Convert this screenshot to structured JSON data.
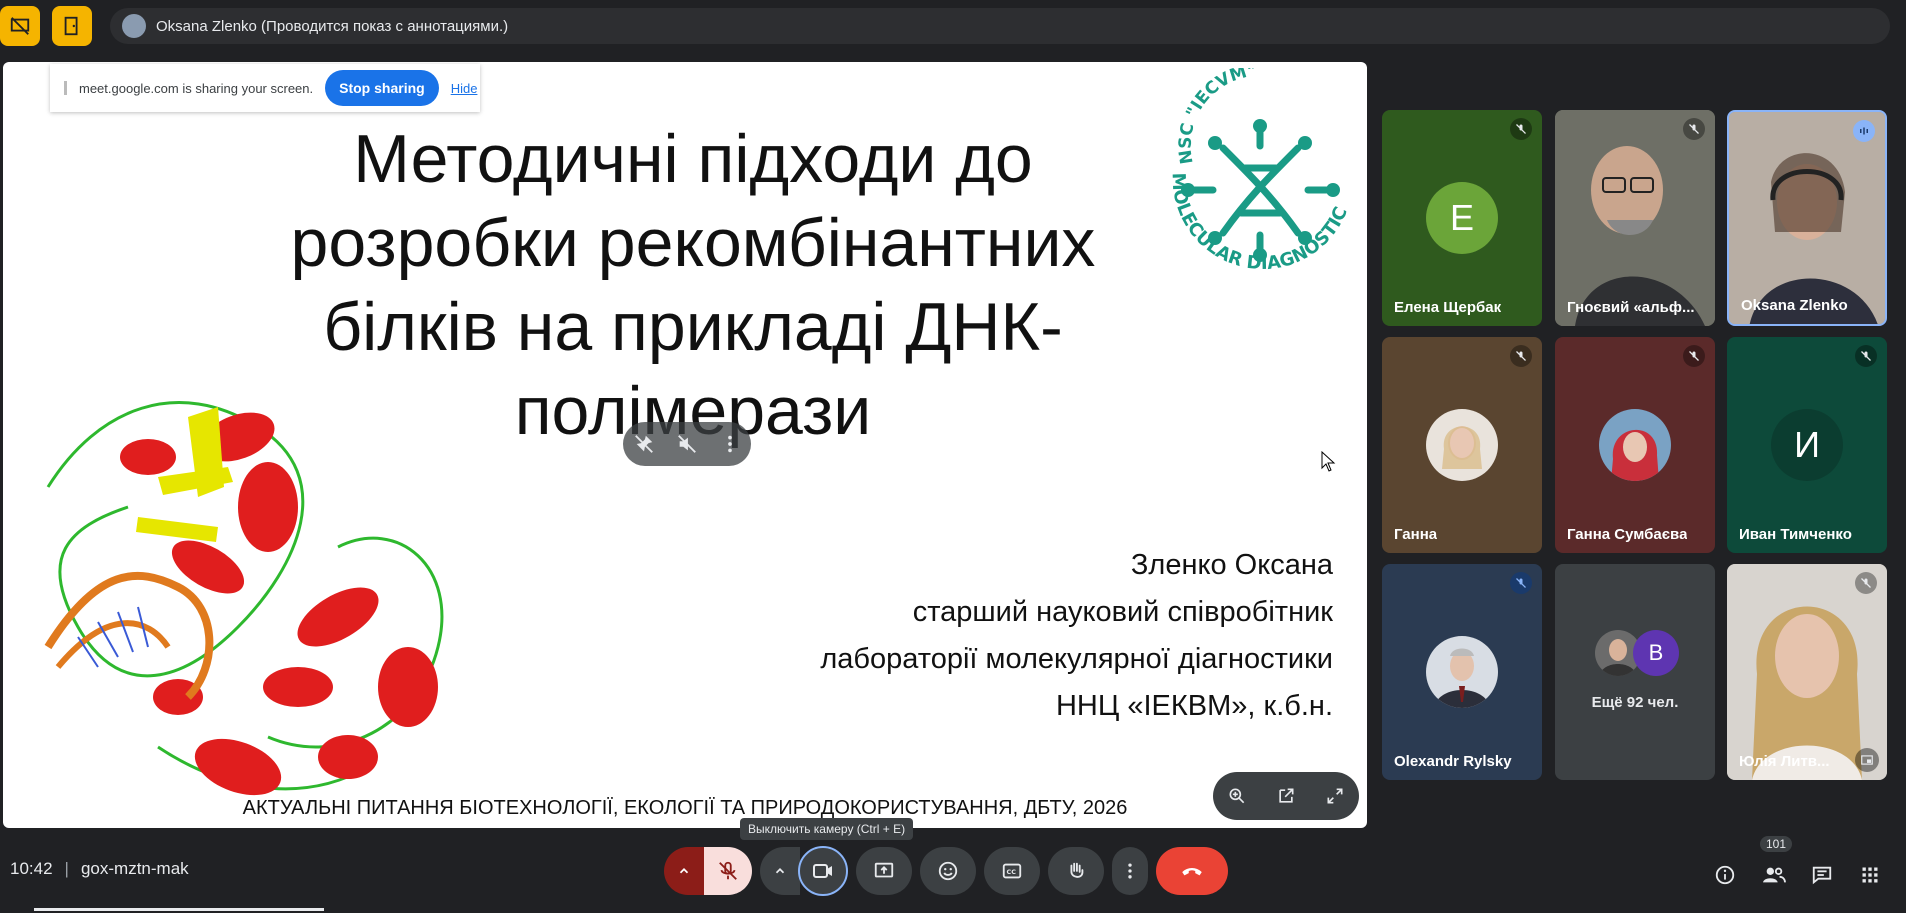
{
  "presenter_banner": "Oksana Zlenko (Проводится показ с аннотациями.)",
  "share_notice": {
    "text": "meet.google.com is sharing your screen.",
    "stop_label": "Stop sharing",
    "hide_label": "Hide"
  },
  "slide": {
    "title_lines": [
      "Методичні підходи до",
      "розробки рекомбінантних",
      "білків на прикладі ДНК-",
      "полімерази"
    ],
    "logo_top": "NSC \"IECVM\"",
    "logo_bottom": "MOLECULAR DIAGNOSTICS",
    "author_lines": [
      "Зленко Оксана",
      "старший науковий співробітник",
      "лабораторії молекулярної діагностики",
      "ННЦ «ІЕКВМ», к.б.н."
    ],
    "footer": "АКТУАЛЬНІ ПИТАННЯ БІОТЕХНОЛОГІЇ, ЕКОЛОГІЇ ТА ПРИРОДОКОРИСТУВАННЯ, ДБТУ, 2026"
  },
  "participants": [
    {
      "name": "Елена Щербак",
      "initial": "E",
      "bg": "#2f5a1e",
      "avatar_color": "#6ba539",
      "muted": true
    },
    {
      "name": "Гноєвий «альф...",
      "initial": "",
      "bg": "#6b6e62",
      "muted": true
    },
    {
      "name": "Oksana Zlenko",
      "initial": "",
      "bg": "#a89c8f",
      "speaking": true
    },
    {
      "name": "Ганна",
      "initial": "",
      "bg": "#5a4530",
      "muted": true
    },
    {
      "name": "Ганна Сумбаєва",
      "initial": "",
      "bg": "#5b2a2a",
      "muted": true
    },
    {
      "name": "Иван Тимченко",
      "initial": "И",
      "bg": "#0d4a3a",
      "avatar_color": "#0b3d30",
      "muted": true
    },
    {
      "name": "Olexandr Rylsky",
      "initial": "",
      "bg": "#2b3b52",
      "muted": true
    },
    {
      "name": "Ещё 92 чел.",
      "initial": "B",
      "bg": "#3c4043",
      "avatar_color": "#5e35b1"
    },
    {
      "name": "Юлія Литв...",
      "initial": "",
      "bg": "#8a8480",
      "muted": true
    }
  ],
  "bottom": {
    "time": "10:42",
    "meeting_code": "gox-mztn-mak",
    "tooltip": "Выключить камеру (Ctrl + E)",
    "participant_count": "101"
  },
  "colors": {
    "accent_yellow": "#f5b400",
    "hangup_red": "#ea4335",
    "mic_off_bg": "#f9dedc",
    "logo_teal": "#1a9b86"
  }
}
